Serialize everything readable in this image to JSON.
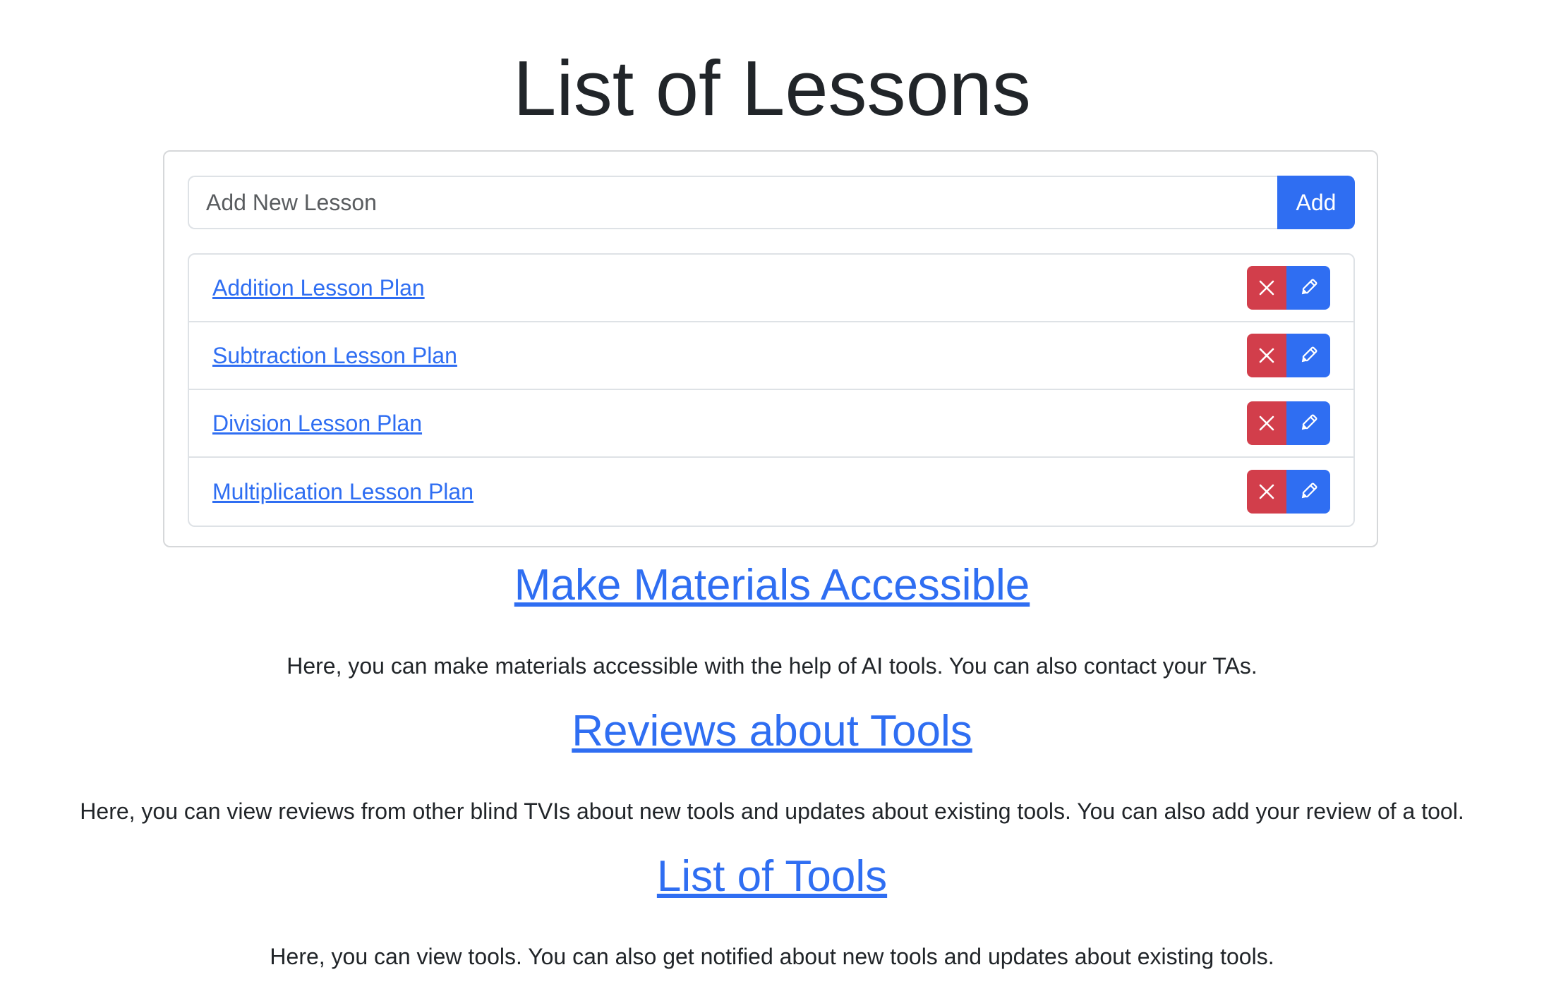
{
  "page": {
    "title": "List of Lessons"
  },
  "new_lesson": {
    "placeholder": "Add New Lesson",
    "value": "",
    "add_label": "Add"
  },
  "lessons": [
    {
      "label": "Addition Lesson Plan",
      "delete_icon": "close-icon",
      "edit_icon": "pencil-icon"
    },
    {
      "label": "Subtraction Lesson Plan",
      "delete_icon": "close-icon",
      "edit_icon": "pencil-icon"
    },
    {
      "label": "Division Lesson Plan",
      "delete_icon": "close-icon",
      "edit_icon": "pencil-icon"
    },
    {
      "label": "Multiplication Lesson Plan",
      "delete_icon": "close-icon",
      "edit_icon": "pencil-icon"
    }
  ],
  "sections": [
    {
      "heading": "Make Materials Accessible",
      "text": "Here, you can make materials accessible with the help of AI tools. You can also contact your TAs."
    },
    {
      "heading": "Reviews about Tools",
      "text": "Here, you can view reviews from other blind TVIs about new tools and updates about existing tools. You can also add your review of a tool."
    },
    {
      "heading": "List of Tools",
      "text": "Here, you can view tools. You can also get notified about new tools and updates about existing tools."
    }
  ],
  "colors": {
    "primary": "#2f6ef2",
    "danger": "#d23e4b",
    "text": "#212529",
    "border": "#dee2e6"
  }
}
